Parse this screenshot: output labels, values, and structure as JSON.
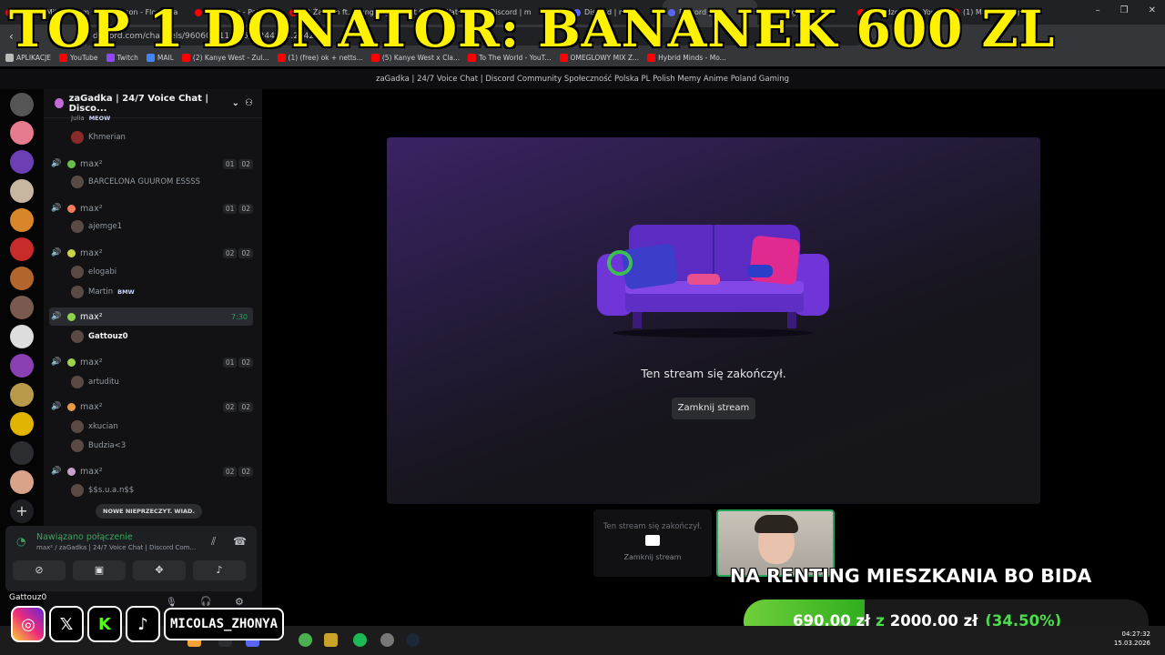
{
  "browser": {
    "tabs": [
      {
        "title": "Forever Mitus - Kam",
        "color": "#ff0000"
      },
      {
        "title": "Zabson - Floyd Ma",
        "color": "#ff0000"
      },
      {
        "title": "Sequento - Pakuj Si",
        "color": "#ff0000"
      },
      {
        "title": "(1) Żabson ft. Young",
        "color": "#ff0000"
      },
      {
        "title": "LeOut Clips - Watch",
        "color": "#9146ff"
      },
      {
        "title": "Discord | m",
        "color": "#5865f2"
      },
      {
        "title": "Discord | m",
        "color": "#5865f2"
      },
      {
        "title": "Discord |",
        "color": "#5865f2"
      },
      {
        "title": "Instagram",
        "color": "#e1306c"
      },
      {
        "title": "Friendzone :( - YouT",
        "color": "#ff0000"
      },
      {
        "title": "(1) M83 'Midnight C",
        "color": "#ff0000"
      }
    ],
    "url": "discord.com/channels/96060…11…96/…24415…2242",
    "bookmarks": [
      {
        "label": "APLIKACJE",
        "color": "#bbbbbb"
      },
      {
        "label": "YouTube",
        "color": "#ff0000"
      },
      {
        "label": "Twitch",
        "color": "#9146ff"
      },
      {
        "label": "MAIL",
        "color": "#4285f4"
      },
      {
        "label": "(2) Kanye West - Zul...",
        "color": "#ff0000"
      },
      {
        "label": "(1) (free) ok + netts...",
        "color": "#ff0000"
      },
      {
        "label": "(5) Kanye West x Cla...",
        "color": "#ff0000"
      },
      {
        "label": "To The World - YouT...",
        "color": "#ff0000"
      },
      {
        "label": "OMEGLOWY MIX Z...",
        "color": "#ff0000"
      },
      {
        "label": "Hybrid Minds - Mo...",
        "color": "#ff0000"
      }
    ]
  },
  "overlay": {
    "banner": "TOP 1 DONATOR: BANANEK 600 ZL",
    "renting": "NA RENTING MIESZKANIA BO BIDA",
    "goal": {
      "current": "690,00 zł",
      "sep": "z",
      "target": "2000,00 zł",
      "percent": "(34.50%)",
      "fraction": 0.345
    },
    "handle": "MICOLAS_ZHONYA"
  },
  "window_title": "zaGadka | 24/7 Voice Chat | Discord Community Społeczność Polska PL Polish Memy Anime Poland Gaming",
  "server_name": "zaGadka | 24/7 Voice Chat | Disco...",
  "channels": [
    {
      "name": "max²",
      "counts": [
        "01",
        "02"
      ],
      "dot": "#6abf4b",
      "users": [
        {
          "name": "BARCELONA GUUROM ESSSS"
        }
      ]
    },
    {
      "name": "max²",
      "counts": [
        "01",
        "02"
      ],
      "dot": "#f47c5b",
      "users": [
        {
          "name": "ajemge1"
        }
      ]
    },
    {
      "name": "max²",
      "counts": [
        "02",
        "02"
      ],
      "dot": "#c9d34a",
      "users": [
        {
          "name": "elogabi"
        },
        {
          "name": "Martin",
          "badge": "BMW"
        }
      ]
    },
    {
      "name": "max²",
      "time": "7:30",
      "dot": "#8fd14f",
      "selected": true,
      "users": [
        {
          "name": "Gattouz0",
          "me": true
        }
      ]
    },
    {
      "name": "max²",
      "counts": [
        "01",
        "02"
      ],
      "dot": "#9fd34a",
      "users": [
        {
          "name": "artuditu"
        }
      ]
    },
    {
      "name": "max²",
      "counts": [
        "02",
        "02"
      ],
      "dot": "#e79a45",
      "users": [
        {
          "name": "xkucian"
        },
        {
          "name": "Budzia<3"
        }
      ]
    },
    {
      "name": "max²",
      "counts": [
        "02",
        "02"
      ],
      "dot": "#c8a2c8",
      "users": [
        {
          "name": "$$s.u.a.n$$"
        }
      ]
    }
  ],
  "partial_users": {
    "top_user": "Khmerian",
    "clipped_top": "Julia",
    "clipped_badge": "MEOW"
  },
  "new_messages": "NOWE NIEPRZECZYT. WIAD.",
  "voice": {
    "status": "Nawiązano połączenie",
    "channel": "max² / zaGadka | 24/7 Voice Chat | Discord Com...",
    "username": "Gattouz0"
  },
  "stream": {
    "ended": "Ten stream się zakończył.",
    "close": "Zamknij stream"
  },
  "taskbar": {
    "time": "04:27:32",
    "date": "15.03.2026"
  }
}
